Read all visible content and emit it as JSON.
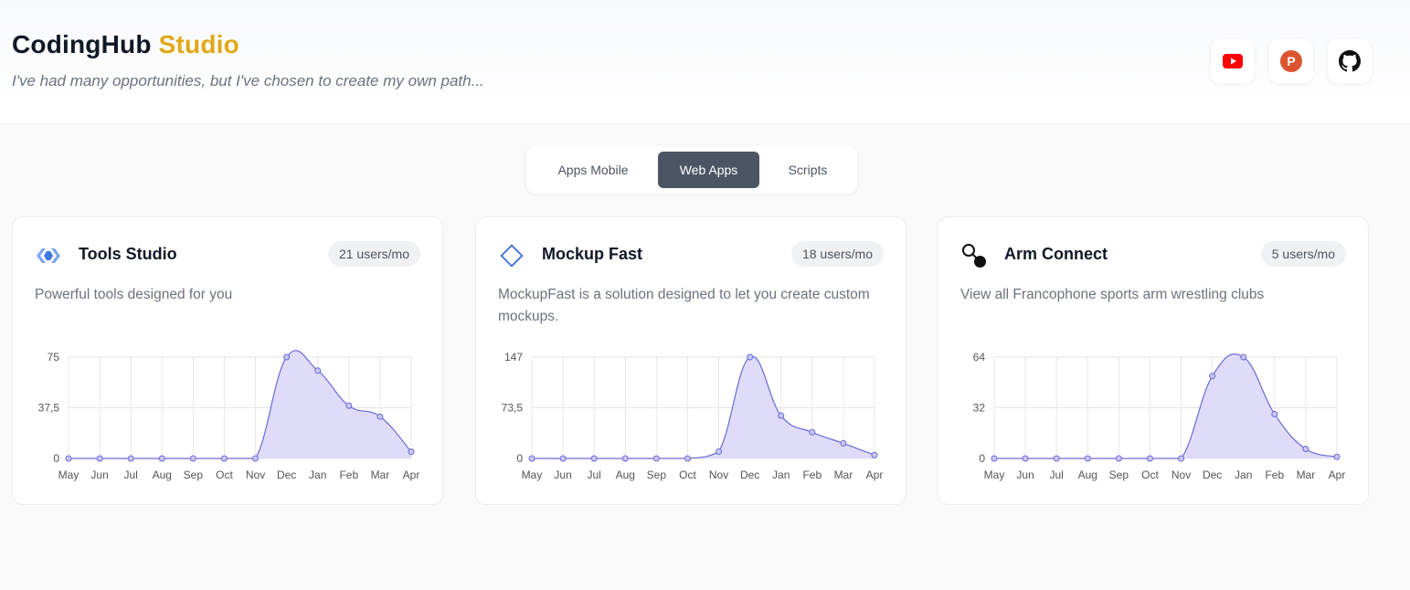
{
  "header": {
    "brand_main": "CodingHub",
    "brand_accent": "Studio",
    "tagline": "I've had many opportunities, but I've chosen to create my own path...",
    "social": [
      {
        "name": "youtube-icon",
        "color": "#ff0000"
      },
      {
        "name": "producthunt-icon",
        "color": "#da552f",
        "letter": "P"
      },
      {
        "name": "github-icon",
        "color": "#111111"
      }
    ]
  },
  "tabs": [
    {
      "label": "Apps Mobile",
      "active": false
    },
    {
      "label": "Web Apps",
      "active": true
    },
    {
      "label": "Scripts",
      "active": false
    }
  ],
  "cards": [
    {
      "title": "Tools Studio",
      "badge": "21 users/mo",
      "description": "Powerful tools designed for you",
      "icon": "tools-studio-icon"
    },
    {
      "title": "Mockup Fast",
      "badge": "18 users/mo",
      "description": "MockupFast is a solution designed to let you create custom mockups.",
      "icon": "mockup-diamond-icon"
    },
    {
      "title": "Arm Connect",
      "badge": "5 users/mo",
      "description": "View all Francophone sports arm wrestling clubs",
      "icon": "arm-connect-icon"
    }
  ],
  "chart_data": [
    {
      "type": "area",
      "categories": [
        "May",
        "Jun",
        "Jul",
        "Aug",
        "Sep",
        "Oct",
        "Nov",
        "Dec",
        "Jan",
        "Feb",
        "Mar",
        "Apr"
      ],
      "values": [
        0,
        0,
        0,
        0,
        0,
        0,
        0,
        75,
        65,
        39,
        31,
        5
      ],
      "ylim": [
        0,
        75
      ],
      "yticks": [
        "0",
        "37,5",
        "75"
      ],
      "grid": true,
      "color": "#6b6bd6",
      "fill": "#dedcf8"
    },
    {
      "type": "area",
      "categories": [
        "May",
        "Jun",
        "Jul",
        "Aug",
        "Sep",
        "Oct",
        "Nov",
        "Dec",
        "Jan",
        "Feb",
        "Mar",
        "Apr"
      ],
      "values": [
        0,
        0,
        0,
        0,
        0,
        0,
        10,
        147,
        62,
        38,
        22,
        5
      ],
      "ylim": [
        0,
        147
      ],
      "yticks": [
        "0",
        "73,5",
        "147"
      ],
      "grid": true,
      "color": "#6b6bd6",
      "fill": "#dedcf8"
    },
    {
      "type": "area",
      "categories": [
        "May",
        "Jun",
        "Jul",
        "Aug",
        "Sep",
        "Oct",
        "Nov",
        "Dec",
        "Jan",
        "Feb",
        "Mar",
        "Apr"
      ],
      "values": [
        0,
        0,
        0,
        0,
        0,
        0,
        0,
        52,
        64,
        28,
        6,
        1
      ],
      "ylim": [
        0,
        64
      ],
      "yticks": [
        "0",
        "32",
        "64"
      ],
      "grid": true,
      "color": "#6b6bd6",
      "fill": "#dedcf8"
    }
  ]
}
